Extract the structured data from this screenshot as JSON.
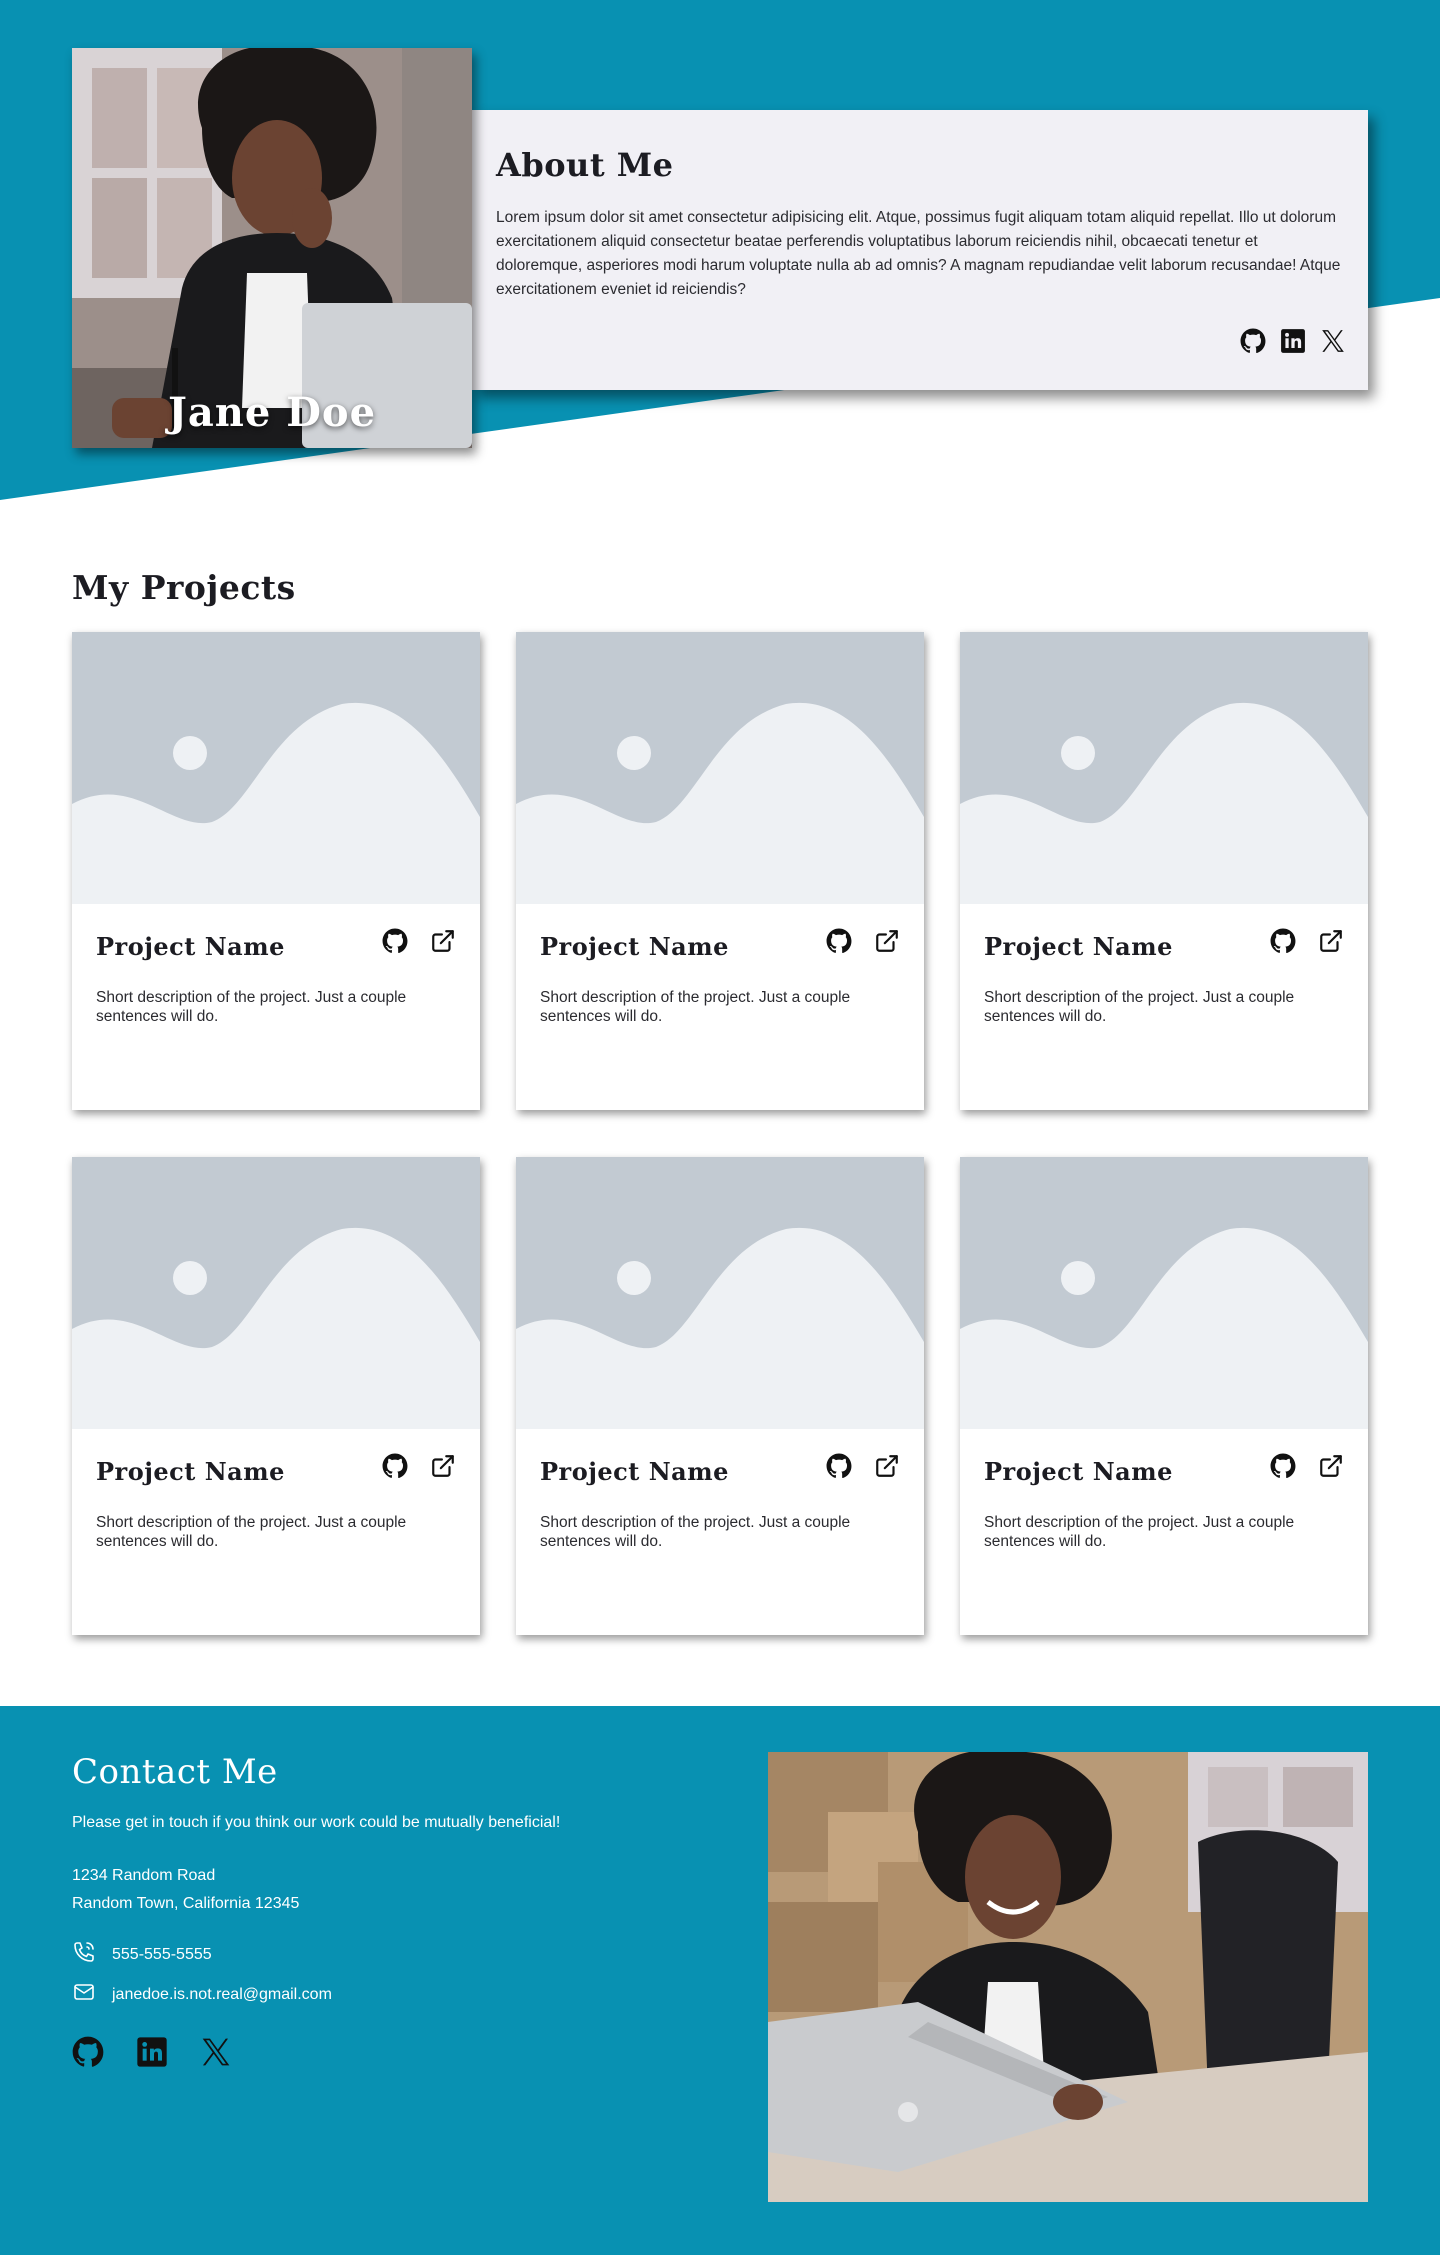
{
  "hero": {
    "name": "Jane Doe"
  },
  "about": {
    "title": "About Me",
    "body": "Lorem ipsum dolor sit amet consectetur adipisicing elit. Atque, possimus fugit aliquam totam aliquid repellat. Illo ut dolorum exercitationem aliquid consectetur beatae perferendis voluptatibus laborum reiciendis nihil, obcaecati tenetur et doloremque, asperiores modi harum voluptate nulla ab ad omnis? A magnam repudiandae velit laborum recusandae! Atque exercitationem eveniet id reiciendis?",
    "social_icons": [
      "github-icon",
      "linkedin-icon",
      "x-icon"
    ]
  },
  "projects": {
    "title": "My Projects",
    "items": [
      {
        "name": "Project Name",
        "description": "Short description of the project. Just a couple sentences will do."
      },
      {
        "name": "Project Name",
        "description": "Short description of the project. Just a couple sentences will do."
      },
      {
        "name": "Project Name",
        "description": "Short description of the project. Just a couple sentences will do."
      },
      {
        "name": "Project Name",
        "description": "Short description of the project. Just a couple sentences will do."
      },
      {
        "name": "Project Name",
        "description": "Short description of the project. Just a couple sentences will do."
      },
      {
        "name": "Project Name",
        "description": "Short description of the project. Just a couple sentences will do."
      }
    ],
    "link_icons": [
      "github-icon",
      "external-link-icon"
    ]
  },
  "contact": {
    "title": "Contact Me",
    "intro": "Please get in touch if you think our work could be mutually beneficial!",
    "address_line1": "1234 Random Road",
    "address_line2": "Random Town, California 12345",
    "phone": "555-555-5555",
    "email": "janedoe.is.not.real@gmail.com",
    "social_icons": [
      "github-icon",
      "linkedin-icon",
      "x-icon"
    ]
  },
  "colors": {
    "accent": "#0891b2",
    "card_background": "#f1f0f5",
    "placeholder_light": "#eef1f4",
    "placeholder_dark": "#c2cad2"
  }
}
